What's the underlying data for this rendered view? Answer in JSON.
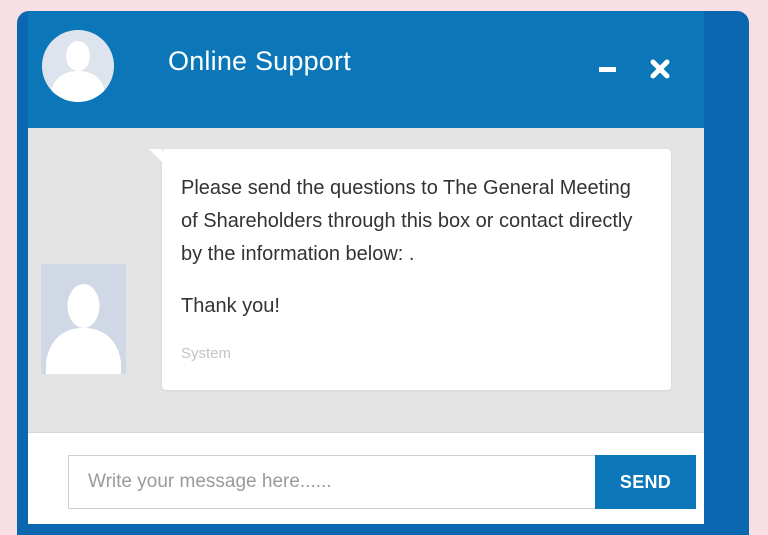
{
  "header": {
    "title": "Online Support",
    "avatar_icon": "user-silhouette-icon",
    "minimize_icon": "minimize-icon",
    "close_icon": "close-icon"
  },
  "message": {
    "avatar_icon": "user-silhouette-icon",
    "text": "Please send the questions to The General Meeting of Shareholders through this box or contact directly by the information below: .",
    "thanks": "Thank you!",
    "sender": "System"
  },
  "composer": {
    "placeholder": "Write your message here......",
    "value": "",
    "send_label": "SEND"
  },
  "colors": {
    "accent": "#0b76b8",
    "frame": "#0c67b1",
    "page_background": "#f7dfe3",
    "messages_background": "#e4e4e4"
  }
}
